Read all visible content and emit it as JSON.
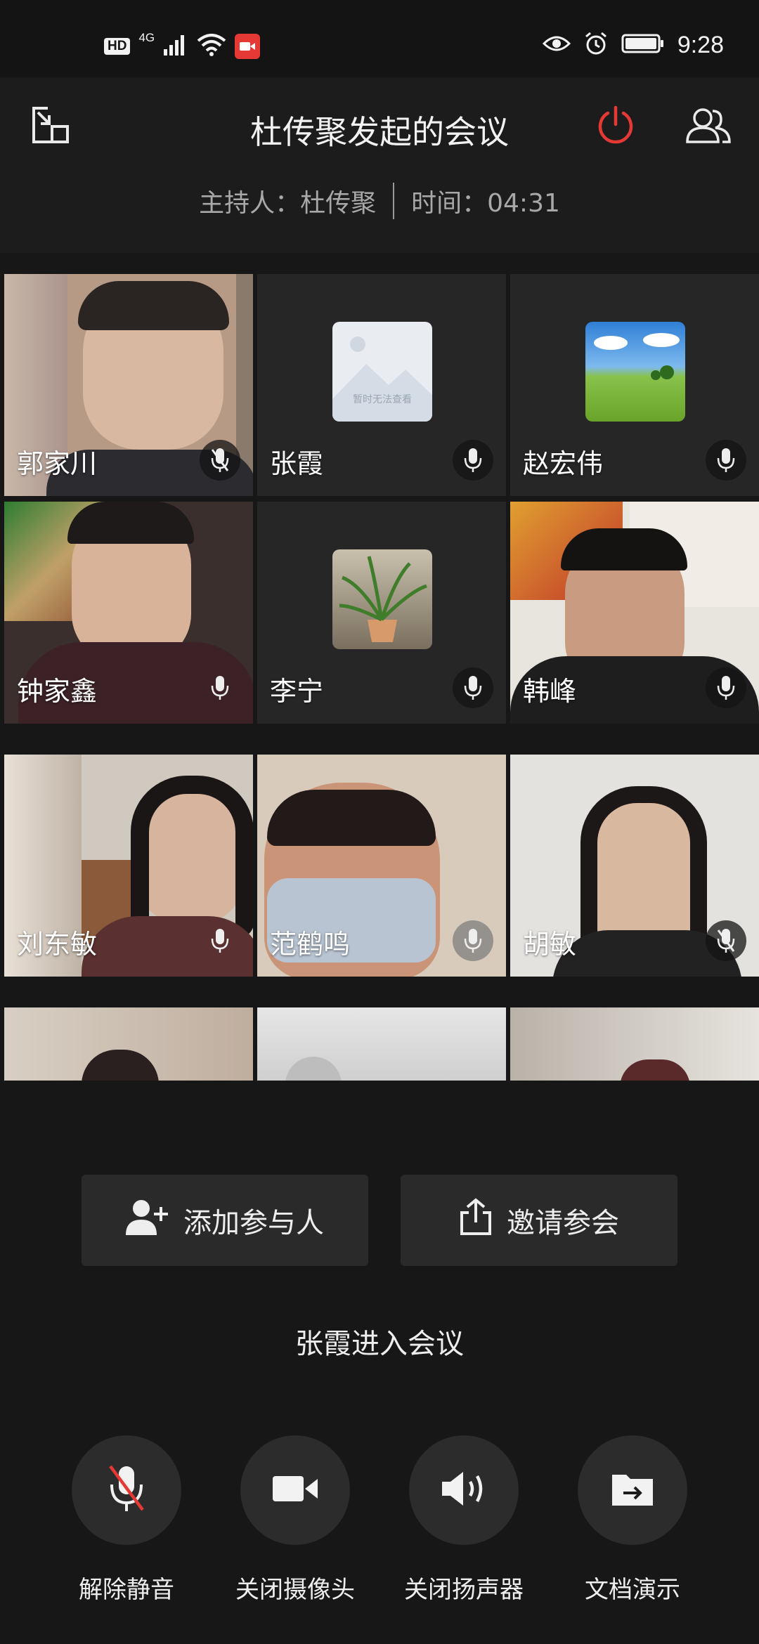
{
  "status_bar": {
    "hd": "HD",
    "network": "4G",
    "time": "9:28",
    "icons": [
      "signal-icon",
      "wifi-icon",
      "screen-record-icon",
      "eye-icon",
      "alarm-icon",
      "battery-icon"
    ]
  },
  "header": {
    "title": "杜传聚发起的会议",
    "host_label": "主持人：杜传聚",
    "time_label": "时间：04:31",
    "icons": [
      "minimize-window-icon",
      "power-icon",
      "participants-icon"
    ],
    "accent_color": "#e53935"
  },
  "participants": [
    {
      "name": "郭家川",
      "muted": true,
      "video": "camera"
    },
    {
      "name": "张霞",
      "muted": false,
      "video": "placeholder",
      "placeholder_text": "暂时无法查看"
    },
    {
      "name": "赵宏伟",
      "muted": false,
      "video": "avatar-landscape"
    },
    {
      "name": "钟家鑫",
      "muted": false,
      "video": "camera"
    },
    {
      "name": "李宁",
      "muted": false,
      "video": "avatar-plant"
    },
    {
      "name": "韩峰",
      "muted": false,
      "video": "camera"
    },
    {
      "name": "刘东敏",
      "muted": false,
      "video": "camera"
    },
    {
      "name": "范鹤鸣",
      "muted": false,
      "video": "camera"
    },
    {
      "name": "胡敏",
      "muted": true,
      "video": "camera"
    },
    {
      "name": "",
      "video": "camera"
    },
    {
      "name": "",
      "video": "camera"
    },
    {
      "name": "",
      "video": "camera"
    }
  ],
  "actions": {
    "add_participant": "添加参与人",
    "invite": "邀请参会"
  },
  "notice": "张霞进入会议",
  "controls": {
    "unmute": "解除静音",
    "camera_off": "关闭摄像头",
    "speaker_off": "关闭扬声器",
    "present_doc": "文档演示"
  }
}
